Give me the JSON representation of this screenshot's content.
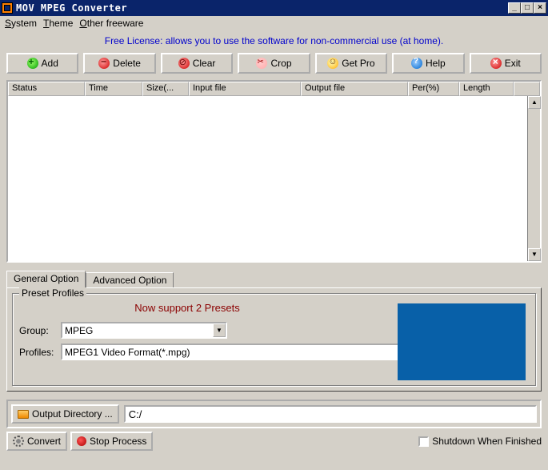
{
  "window": {
    "title": "MOV MPEG Converter"
  },
  "menu": {
    "system": "System",
    "theme": "Theme",
    "other": "Other freeware"
  },
  "license_text": "Free License: allows you to use the software for non-commercial use (at home).",
  "toolbar": {
    "add": "Add",
    "delete": "Delete",
    "clear": "Clear",
    "crop": "Crop",
    "getpro": "Get Pro",
    "help": "Help",
    "exit": "Exit"
  },
  "columns": {
    "status": "Status",
    "time": "Time",
    "size": "Size(...",
    "input": "Input file",
    "output": "Output file",
    "per": "Per(%)",
    "length": "Length"
  },
  "tabs": {
    "general": "General Option",
    "advanced": "Advanced Option"
  },
  "preset": {
    "legend": "Preset Profiles",
    "message": "Now support 2 Presets",
    "group_label": "Group:",
    "group_value": "MPEG",
    "profiles_label": "Profiles:",
    "profiles_value": "MPEG1 Video Format(*.mpg)"
  },
  "output": {
    "button": "Output Directory ...",
    "path": "C:/"
  },
  "actions": {
    "convert": "Convert",
    "stop": "Stop Process",
    "shutdown": "Shutdown When Finished"
  }
}
